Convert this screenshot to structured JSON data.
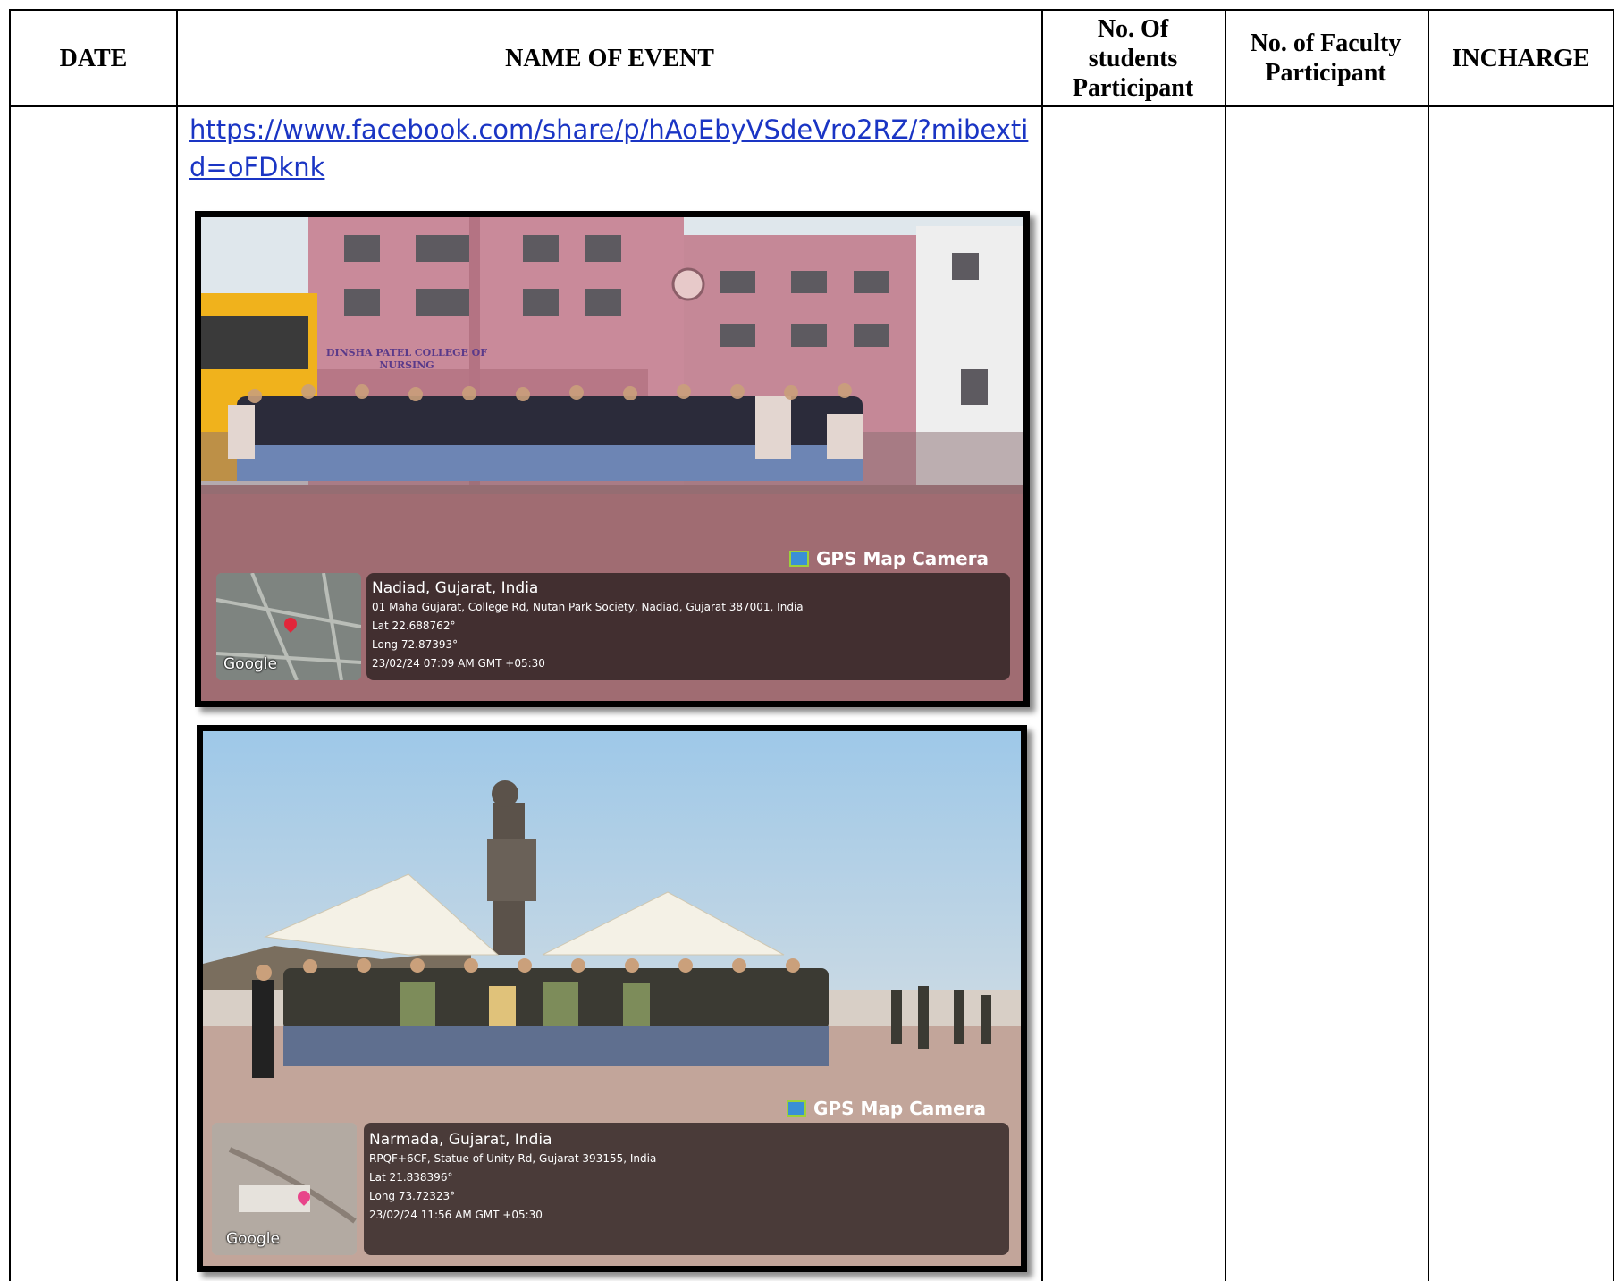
{
  "table": {
    "headers": {
      "date": "DATE",
      "event": "NAME OF EVENT",
      "students": "No. Of students Participant",
      "faculty": "No. of Faculty Participant",
      "incharge": "INCHARGE"
    },
    "event_link": "https://www.facebook.com/share/p/hAoEbyVSdeVro2RZ/?mibextid=oFDknk"
  },
  "photos": [
    {
      "sign_text": "DINSHA PATEL COLLEGE OF NURSING",
      "gps": {
        "badge": "GPS Map Camera",
        "place": "Nadiad, Gujarat, India",
        "address": "01 Maha Gujarat, College Rd, Nutan Park Society, Nadiad, Gujarat 387001, India",
        "lat": "Lat 22.688762°",
        "long": "Long 72.87393°",
        "datetime": "23/02/24 07:09 AM GMT +05:30",
        "map_label": "Google"
      }
    },
    {
      "gps": {
        "badge": "GPS Map Camera",
        "place": "Narmada, Gujarat, India",
        "address": "RPQF+6CF, Statue of Unity Rd, Gujarat 393155, India",
        "lat": "Lat 21.838396°",
        "long": "Long 73.72323°",
        "datetime": "23/02/24 11:56 AM GMT +05:30",
        "map_label": "Google"
      }
    }
  ],
  "colors": {
    "link": "#1a35c4",
    "building": "#c98a9a",
    "sky": "#cfe2ef"
  }
}
